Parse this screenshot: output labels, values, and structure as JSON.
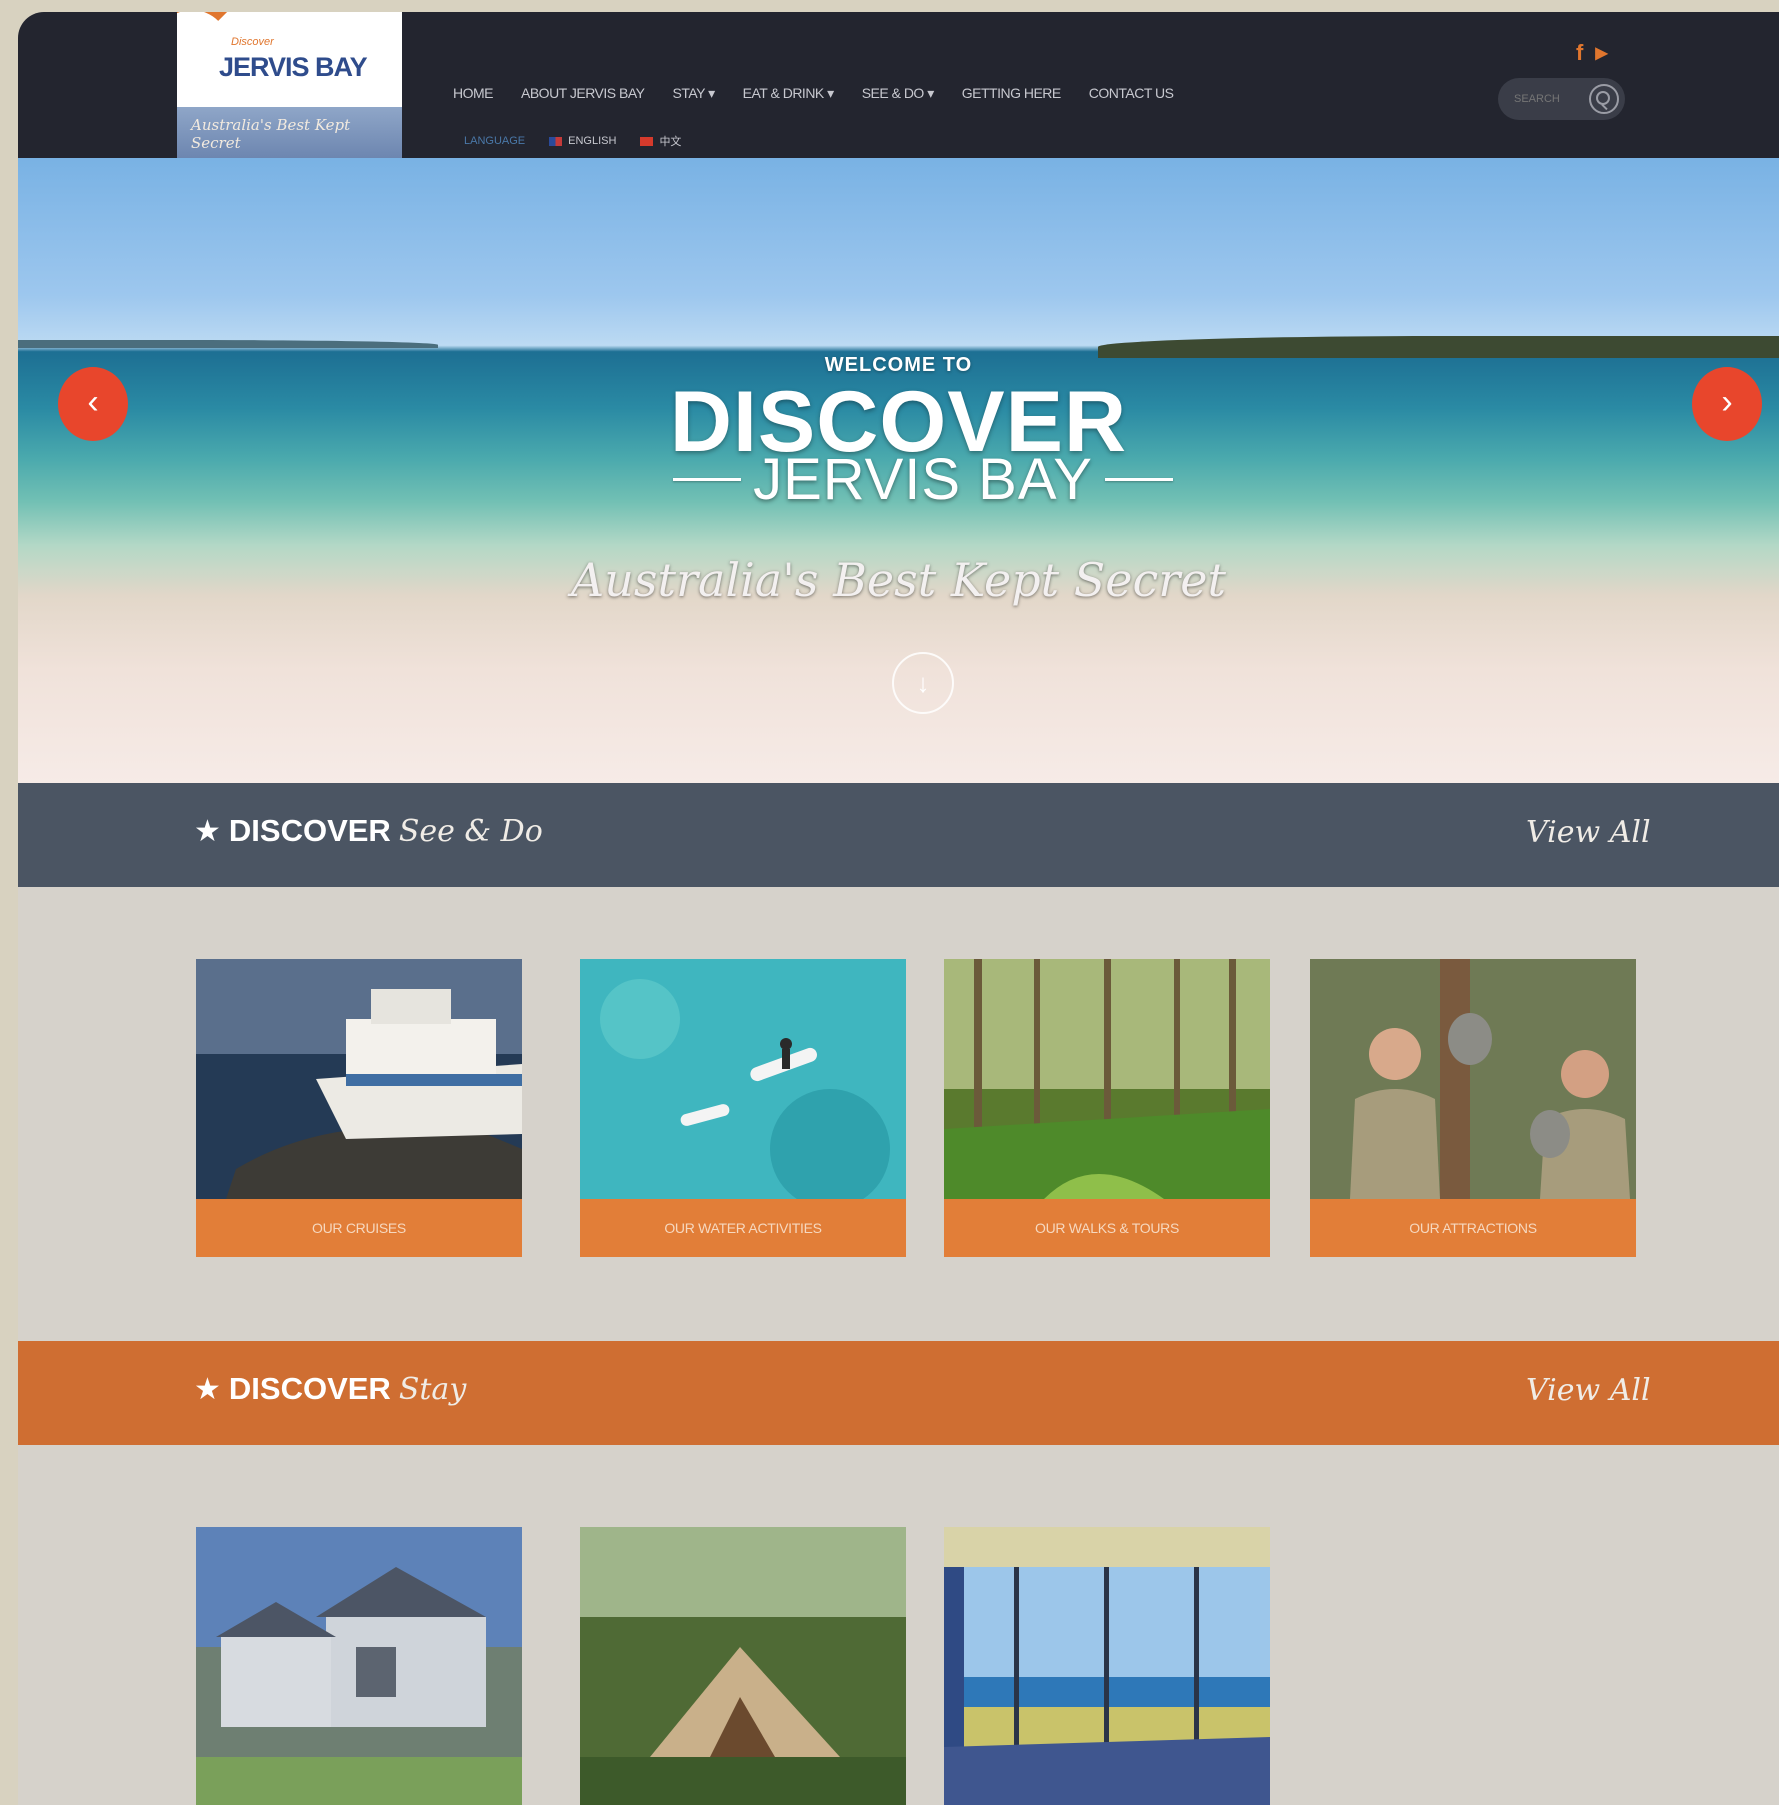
{
  "logo": {
    "small": "Discover",
    "name": "JERVIS BAY",
    "tagline": "Australia's Best Kept Secret"
  },
  "nav": {
    "items": [
      "HOME",
      "ABOUT JERVIS BAY",
      "STAY ▾",
      "EAT & DRINK ▾",
      "SEE & DO ▾",
      "GETTING HERE",
      "CONTACT US"
    ],
    "language_label": "LANGUAGE",
    "languages": [
      "ENGLISH",
      "中文"
    ]
  },
  "social": {
    "icons": [
      "facebook-icon",
      "youtube-icon"
    ],
    "facebook_glyph": "f",
    "youtube_glyph": "▶"
  },
  "search": {
    "placeholder": "SEARCH"
  },
  "hero": {
    "welcome": "WELCOME TO",
    "discover": "DISCOVER",
    "place": "JERVIS BAY",
    "tagline": "Australia's Best Kept Secret",
    "prev_glyph": "‹",
    "next_glyph": "›",
    "scroll_glyph": "↓"
  },
  "see_do": {
    "star": "★",
    "title_bold": "DISCOVER",
    "title_script": "See & Do",
    "view_all": "View All",
    "cards": [
      {
        "label": "OUR CRUISES"
      },
      {
        "label": "OUR WATER ACTIVITIES"
      },
      {
        "label": "OUR WALKS & TOURS"
      },
      {
        "label": "OUR ATTRACTIONS"
      }
    ]
  },
  "stay": {
    "star": "★",
    "title_bold": "DISCOVER",
    "title_script": "Stay",
    "view_all": "View All"
  },
  "colors": {
    "header": "#23252f",
    "accent": "#e27e38",
    "slate_bar": "#4b5563",
    "orange_bar": "#cf6e32",
    "arrow": "#e8462c"
  }
}
